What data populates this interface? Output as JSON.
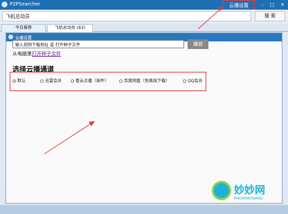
{
  "window": {
    "title": "P2PSearcher",
    "cloud_label": "云播设置",
    "min_glyph": "–",
    "max_glyph": "□",
    "close_glyph": "✕"
  },
  "search": {
    "value": "飞机总动员",
    "button_label": "搜 索"
  },
  "tabs": [
    {
      "label": "今日推荐"
    },
    {
      "label": "飞机总动员 (83)"
    }
  ],
  "dialog": {
    "title": "云播设置",
    "url_value": "输入视频下载地址 或 打开种子文件",
    "play_label": "播放",
    "open_prefix": "从电脑里",
    "open_link": "打开种子文件",
    "section_title": "选择云播通道",
    "channels": [
      {
        "label": "默认",
        "selected": true
      },
      {
        "label": "迅雷会员",
        "selected": false
      },
      {
        "label": "看云点播（插件）",
        "selected": false
      },
      {
        "label": "百度网盘（免离线下载）",
        "selected": false
      },
      {
        "label": "QQ会员",
        "selected": false
      }
    ]
  },
  "watermark": {
    "text": "妙妙网",
    "subtext": "MIAOMIAOWANG"
  },
  "colors": {
    "titlebar": "#1f6fb5",
    "highlight": "#e53935"
  }
}
